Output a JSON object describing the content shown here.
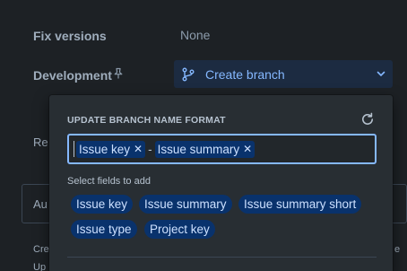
{
  "fields": {
    "fix_versions_label": "Fix versions",
    "fix_versions_value": "None",
    "development_label": "Development",
    "create_branch_label": "Create branch"
  },
  "background": {
    "rep_fragment": "Re",
    "card_fragment": "Au",
    "bottom_left_1": "Cre",
    "bottom_left_2": "Up",
    "bottom_right": "e"
  },
  "popup": {
    "title": "UPDATE BRANCH NAME FORMAT",
    "format_tokens": [
      "Issue key",
      "Issue summary"
    ],
    "separator": "-",
    "select_label": "Select fields to add",
    "fields": [
      "Issue key",
      "Issue summary",
      "Issue summary short",
      "Issue type",
      "Project key"
    ]
  },
  "colors": {
    "accent": "#85b8ff",
    "token_bg": "#09326c",
    "popup_bg": "#282e33",
    "page_bg": "#1d2125"
  }
}
